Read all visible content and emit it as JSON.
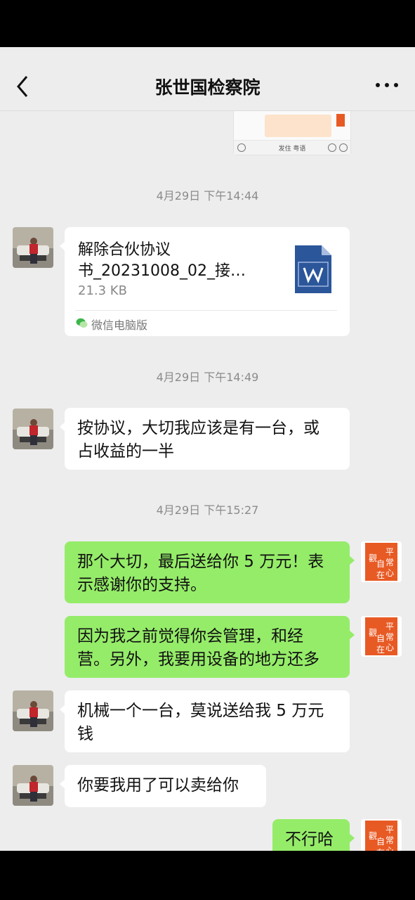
{
  "header": {
    "title": "张世国检察院",
    "back_icon": "chevron-left-icon",
    "more_icon": "more-dots-icon"
  },
  "quoted_image": {
    "caption": "发住 粤语"
  },
  "messages": [
    {
      "type": "time",
      "text": "4月29日 下午14:44"
    },
    {
      "type": "file",
      "side": "left",
      "name_line1": "解除合伙协议",
      "name_line2": "书_20231008_02_接…",
      "size": "21.3 KB",
      "source": "微信电脑版",
      "icon": "word-file-icon"
    },
    {
      "type": "time",
      "text": "4月29日 下午14:49"
    },
    {
      "type": "text",
      "side": "left",
      "line1": "按协议，大切我应该是有一台，或",
      "line2": "占收益的一半"
    },
    {
      "type": "time",
      "text": "4月29日 下午15:27"
    },
    {
      "type": "text",
      "side": "right",
      "line1": "那个大切，最后送给你 5 万元！表",
      "line2": "示感谢你的支持。"
    },
    {
      "type": "text",
      "side": "right",
      "line1": "因为我之前觉得你会管理，和经",
      "line2": "营。另外，我要用设备的地方还多"
    },
    {
      "type": "text",
      "side": "left",
      "line1": "机械一个一台，莫说送给我 5 万元",
      "line2": "钱"
    },
    {
      "type": "text",
      "side": "left",
      "line1": "你要我用了可以卖给你"
    },
    {
      "type": "text",
      "side": "right",
      "line1": "不行哈"
    }
  ],
  "avatars": {
    "contact_icon": "contact-photo-avatar",
    "self_icon": "calligraphy-avatar",
    "self_chars": [
      "平",
      "常",
      "心",
      "觀",
      "自",
      "在"
    ]
  },
  "colors": {
    "background": "#ededed",
    "self_bubble": "#95ec69",
    "other_bubble": "#ffffff",
    "avatar_red": "#e85a24"
  }
}
